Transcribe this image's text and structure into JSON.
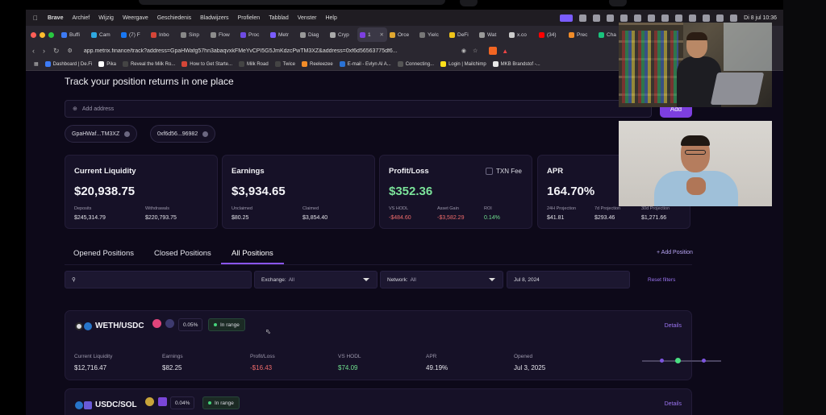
{
  "macbar": {
    "app": "Brave",
    "menus": [
      "Archief",
      "Wijzig",
      "Weergave",
      "Geschiedenis",
      "Bladwijzers",
      "Profielen",
      "Tabblad",
      "Venster",
      "Help"
    ],
    "datetime": "Di 8 jul 10:36"
  },
  "tabs": [
    {
      "label": "Buffi",
      "color": "#3d7bf5"
    },
    {
      "label": "Cam",
      "color": "#2fa9e0"
    },
    {
      "label": "(7) F",
      "color": "#1877f2"
    },
    {
      "label": "Inbo",
      "color": "#d44638"
    },
    {
      "label": "Sinp",
      "color": "#888888"
    },
    {
      "label": "Flow",
      "color": "#8c8c8c"
    },
    {
      "label": "Proc",
      "color": "#6e4be3"
    },
    {
      "label": "Metr",
      "color": "#7a5cff"
    },
    {
      "label": "Diag",
      "color": "#999999"
    },
    {
      "label": "Cryp",
      "color": "#aaaaaa"
    },
    {
      "label": "1",
      "color": "#7d3fe0",
      "active": true
    },
    {
      "label": "Orce",
      "color": "#e0a72f"
    },
    {
      "label": "Yielc",
      "color": "#777777"
    },
    {
      "label": "DeFi",
      "color": "#f0c419"
    },
    {
      "label": "Wat",
      "color": "#9a9a9a"
    },
    {
      "label": "x.co",
      "color": "#cccccc"
    },
    {
      "label": "(34)",
      "color": "#ff0000"
    },
    {
      "label": "Prec",
      "color": "#f28c28"
    },
    {
      "label": "Cha",
      "color": "#19c37d"
    }
  ],
  "address_bar": {
    "url": "app.metrix.finance/track?address=GpaHWafg57hn3abaqvxkFMeYvCPI5G5JmKdzcPwTM3XZ&address=0xf6d56563775df6..."
  },
  "bookmarks": [
    {
      "label": "Dashboard | De.Fi",
      "color": "#3d7bf5"
    },
    {
      "label": "Pika",
      "color": "#ffffff"
    },
    {
      "label": "Reveal the Milk Ro...",
      "color": "#444444"
    },
    {
      "label": "How to Get Starte...",
      "color": "#d44638"
    },
    {
      "label": "Milk Road",
      "color": "#444444"
    },
    {
      "label": "Twice",
      "color": "#444444"
    },
    {
      "label": "Reeleezee",
      "color": "#f28c28"
    },
    {
      "label": "E-mail - Evlyn Al A...",
      "color": "#2a72d4"
    },
    {
      "label": "Connecting...",
      "color": "#555555"
    },
    {
      "label": "Login | Mailchimp",
      "color": "#ffe01b"
    },
    {
      "label": "MKB Brandstof -...",
      "color": "#e9e9e9"
    }
  ],
  "page": {
    "headline": "Track your position returns in one place",
    "address_placeholder": "Add address",
    "add_button": "Add",
    "chips": [
      "GpaHWaf...TM3XZ",
      "0xf6d56...96982"
    ]
  },
  "cards": {
    "liquidity": {
      "title": "Current Liquidity",
      "value": "$20,938.75",
      "s1_label": "Deposits",
      "s1_value": "$245,314.79",
      "s2_label": "Withdrawals",
      "s2_value": "$220,793.75"
    },
    "earnings": {
      "title": "Earnings",
      "value": "$3,934.65",
      "s1_label": "Unclaimed",
      "s1_value": "$80.25",
      "s2_label": "Claimed",
      "s2_value": "$3,854.40"
    },
    "profit": {
      "title": "Profit/Loss",
      "value": "$352.36",
      "txn_fee": "TXN Fee",
      "s1_label": "VS HODL",
      "s1_value": "-$484.60",
      "s2_label": "Asset Gain",
      "s2_value": "-$3,582.29",
      "s3_label": "ROI",
      "s3_value": "0.14%"
    },
    "apr": {
      "title": "APR",
      "value": "164.70%",
      "s1_label": "24H Projection",
      "s1_value": "$41.81",
      "s2_label": "7d Projection",
      "s2_value": "$293.46",
      "s3_label": "30d Projection",
      "s3_value": "$1,271.66"
    }
  },
  "position_tabs": {
    "opened": "Opened Positions",
    "closed": "Closed Positions",
    "all": "All Positions",
    "add_position": "+ Add Position"
  },
  "filters": {
    "search_placeholder": "",
    "exchange_label": "Exchange:",
    "exchange_value": "All",
    "network_label": "Network:",
    "network_value": "All",
    "date": "Jul 8, 2024",
    "reset": "Reset filters"
  },
  "positions": [
    {
      "pair": "WETH/USDC",
      "fee": "0.05%",
      "status": "In range",
      "details": "Details",
      "metric_labels": [
        "Current Liquidity",
        "Earnings",
        "Profit/Loss",
        "VS HODL",
        "APR",
        "Opened"
      ],
      "metric_values": [
        "$12,716.47",
        "$82.25",
        "-$16.43",
        "$74.09",
        "49.19%",
        "Jul 3, 2025"
      ]
    },
    {
      "pair": "USDC/SOL",
      "fee": "0.04%",
      "status": "In range",
      "details": "Details"
    }
  ]
}
